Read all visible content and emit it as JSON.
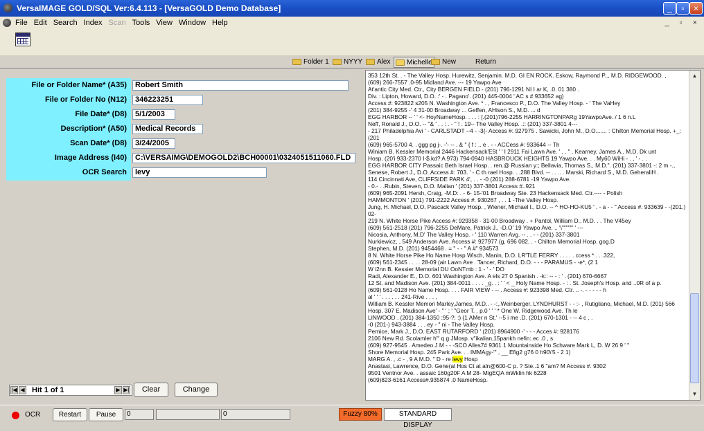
{
  "window": {
    "title": "VersaIMAGE GOLD/SQL Ver:6.4.113 - [VersaGOLD Demo Database]",
    "controls": {
      "minimize": "_",
      "restore": "▫",
      "close": "×"
    }
  },
  "menu": {
    "items": [
      "File",
      "Edit",
      "Search",
      "Index",
      "Scan",
      "Tools",
      "View",
      "Window",
      "Help"
    ],
    "disabled": [
      "Scan"
    ],
    "mdi_controls": "_ ▫ ×"
  },
  "folder_tabs": [
    {
      "label": "Folder 1"
    },
    {
      "label": "NYYY"
    },
    {
      "label": "Alex"
    },
    {
      "label": "Michelle"
    },
    {
      "label": "New"
    },
    {
      "label": "Return"
    }
  ],
  "form": {
    "fields": [
      {
        "label": "File or Folder Name* (A35)",
        "value": "Robert Smith"
      },
      {
        "label": "File or Folder No (N12)",
        "value": "346223251"
      },
      {
        "label": "File Date* (D8)",
        "value": "5/1/2003"
      },
      {
        "label": "Description* (A50)",
        "value": "Medical Records"
      },
      {
        "label": "Scan Date* (D8)",
        "value": "3/24/2005"
      },
      {
        "label": "Image Address (I40)",
        "value": "C:\\VERSAIMG\\DEMOGOLD2\\BCH00001\\0324051511060.FLD"
      },
      {
        "label": "OCR Search",
        "value": "levy"
      }
    ]
  },
  "navigator": {
    "text": "Hit 1 of 1",
    "first": "|◀",
    "prev": "◀",
    "next": "▶",
    "last": "▶|"
  },
  "buttons": {
    "clear": "Clear",
    "change": "Change"
  },
  "ocr_text": {
    "lines_before": [
      "353 12th St. . - The Valley Hosp. Hurewitz, Senjamin. M.D. GI EN ROCK. Eskow, Raymond P.., M.D. RIDGEWOOD. ,",
      "(609) 266-7557 .0-95 Midland Ave. --- 19 Yawpo Ave",
      "At'antic City Med. Ctr., City BERGEN FIELD - (201) 796-1291 NI I ar K, .0. 01 380 .",
      "Div. : Lipton, Howard, D.O. :' - . Pagano'. (201) 445-0004 ' AC s # 933652 ag)",
      "Access #: 923822 s205 N. Washington Ave. * . , Francesco P., D.O. The Valley Hosp. - ' The VaHey",
      "(201) 384-9255 -' 4 31-00 Broadway ... Geffen, AHison S., M.D. ... d",
      "EGG HARBOR -- ' ' <- HoyNameHosp. . . . : [.(201)796-2255 HARRINGTONPARg 19YawpoAve. / 1 6 n.L",
      "Neff, Ronald J., D.O. -- \"& ' . . : . - \" ! . 19-- The Valley Hosp. .:: (201) 337-3801 4---",
      "- 217 Philadelphia Avi ' - CARLSTADT --4 - -3{- Access #: 927975 . Sawicki, John M., D.O....... : Chilton Memorial Hosp. +_:",
      "(201",
      "(609) 965-5700 4. . ggg pg j-. -'- -- . & \" { f : .. e . - - ACCess #: 933644 -- Th",
      "Winiam B. Kessler Memorial 2446 Hackensack'E5t ' ' I 2911 Fai Lawn Ave. ' . . \" . Kearney, James A., M.D. Dk unt",
      "Hosp. (20'i 933-2370 I-$.kd? A 973) 794-0940 HASBROUCK HEIGHTS 19 Yawpo Ave. . . My60 WiHi - . , ' - . .",
      "EGG HARBOR CITY Passaic Beth Israel Hosp. . ren.@ Russian y:; Bellavia, Thomas S., M.D.\". (201) 337-3801 -: 2 m -.,",
      "Senese, Robert J., D.O. Access #: 703. ' - C th rael Hosp. . .288 Blvd. -- . . .. . Marski, Richard S., M.D. GeheraliH .",
      "114 Cincinnati Ave, CLIFFSIDE PARK 4', . . - -0 (201) 288-6781 -19 Yawpo Ave.",
      "- 0.- . .Rubin, Steven, D.O. Malian ' (201) 337-3801 Access #..921",
      "(609) 965-2091 Hersh, Craig, -M.D: . - 6- 15-'01 Broadway Ste. 23 Hackensack Med. Ctr.---- - Polish",
      "HAMMONTON ' (201) 791-2222 Access #. 930267 , . . 1 -The Valley Hosp.",
      "Jung, H. Michael, D.O. Pascack Valley Hosp. , Wiener, Michael I., D.O. -- ^ HO-HO-KU5 ' . - a - - \" Access #. 933639 - -(201.)",
      "02-",
      "219 N. White Horse Pike Access #: 929358 - 31-00 Broadway . + Pantol, William D., M.D. . . The V45ey",
      "(609) 561-2518 (201) 796-2255 DeMare, Patrick J., -D.O' 19 Yawpo Ave. .. '\\\"\"\"\"\"' ' ---",
      "Nicosia, Anthony, M.D' The Valley Hosp. - ' 110 Warren Avg. -- . . - - (201) 337-3801",
      "Nurkiewicz, , 549 Anderson Ave. Access #: 927977 (g, 696 082. . - Chilton Memorial Hosp. gog.D",
      "Stephen, M.D. (201) 9454468 . = \" - - \" A #\" 934573",
      "8 N. White Horse Pike Ho Name Hosp Wisch, Manin, D.O. LR'TLE FERRY . . . . . ccess * . . .322,",
      "(609) 561-2345 . . . . 28-09 (air Lawn Ave . Tancer, Richard, D.O. - - - PARAMUS - -e*, (2 1",
      "W i2nn B. Kessier Memorial DU OoNTmb : 1 - ' - ' DO",
      "Radi, Alexander E., D.O. 601 Washington Ave. A els 27 0 Spanish . -k:: -- - : ' . (201) 670-6667",
      "12 St. and Madison Ave. (201) 384-0011 . . . . _g. . : ' ' < _ Holy Name Hosp. - : . St. Joseph's Hosp. and ..0R of a p.",
      "(609) 561-0128 Ho Name Hosp. . . . FAIR VIEW - -- . Access #: 923398 Med. Ctr. .. -. - - - - - h",
      "al ' ' ' . . . . . . 241-Rive . . . ,",
      "William B. Kessler Memori Marley,James, M.D.. - -:,.Weinberger. LYNDHURST - - :- , Rutigliano, Michael, M.D. (201) 566",
      "Hosp. 307 E. Madison Ave' - \" ' ; ' \"Geor T. . p.0 ' ' ' * One W. Ridgewood Ave. Th le",
      "LINWOOD . (201) 384-1350 :95-?: :) {1 AMer n St.' --5 i me .D. (201) 670-1301 - -- 4 c , .",
      "-0 (201-) 943-3884 . . . ey - \" ni - The Valley Hosp.",
      "Pernice, Mark J., D.O. EAST RUTARFORD ' (201) 8964900 -' - - - Acces #: 928176",
      "2106 New Rd. Scolamler h\"' q g JMosp. v\"ikalian,15pankh nefin:.ec .0 , s",
      "(609) 927-9545 . Amedeo J M - - -SCO Alles7# 9361 1 Mountainside Ho Schware Mark L, D. W 26 9 ' \"",
      "Shore Memorial Hosp. 245 Park Ave. . . IMMAgy-\"' , __ Efig2 g76 0 h90\\'5 - 2 1)"
    ],
    "hit_line_prefix": "MARG A. , .c - , 9 A M.D. \" D - re ",
    "hit_word": "levy",
    "hit_line_suffix": " Hosp",
    "lines_after": [
      "Anastasi, Lawrence, D.O. Gene(al Hos Ct at aln@600-C p. ? Ste..1 6 \"am? M Access #. 9302",
      "9501 Ventnor Ave. . assaic 160g20F A M 28- MigEQA mWklin hk 6228",
      "(609)823-6161 Access#.935874 .0 NameHosp."
    ]
  },
  "statusbar": {
    "ocr_label": "OCR",
    "restart": "Restart",
    "pause": "Pause",
    "field1": "0",
    "field3": "0",
    "fuzzy": "Fuzzy 80%",
    "display_mode": "STANDARD DISPLAY"
  }
}
